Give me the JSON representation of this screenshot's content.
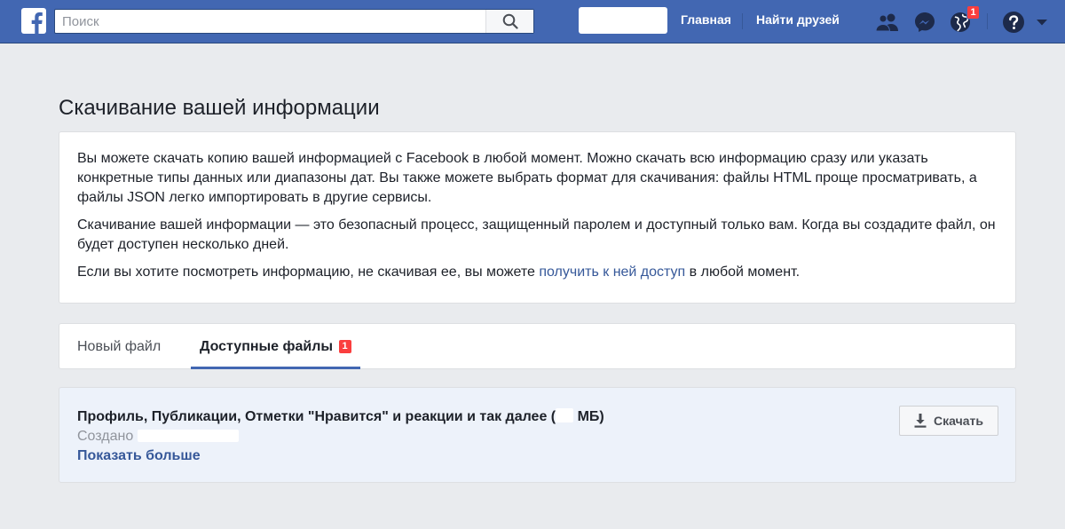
{
  "colors": {
    "topbar": "#4267b2",
    "page_bg": "#e9ebee",
    "link": "#365899",
    "badge": "#fa3e3e",
    "file_card_bg": "#edf2fa"
  },
  "topbar": {
    "logo_icon": "facebook-f-icon",
    "search": {
      "placeholder": "Поиск",
      "value": "",
      "icon": "search-icon"
    },
    "nav": {
      "home_label": "Главная",
      "find_friends_label": "Найти друзей"
    },
    "icons": [
      "friends-icon",
      "messenger-icon",
      "globe-notifications-icon",
      "help-icon",
      "chevron-down-icon"
    ],
    "notifications_badge": "1"
  },
  "page": {
    "title": "Скачивание вашей информации",
    "info": {
      "p1": "Вы можете скачать копию вашей информацией с Facebook в любой момент. Можно скачать всю информацию сразу или указать конкретные типы данных или диапазоны дат. Вы также можете выбрать формат для скачивания: файлы HTML проще просматривать, а файлы JSON легко импортировать в другие сервисы.",
      "p2": "Скачивание вашей информации — это безопасный процесс, защищенный паролем и доступный только вам. Когда вы создадите файл, он будет доступен несколько дней.",
      "p3_before": "Если вы хотите посмотреть информацию, не скачивая ее, вы можете ",
      "p3_link": "получить к ней доступ",
      "p3_after": " в любой момент."
    },
    "tabs": [
      {
        "label": "Новый файл",
        "active": false
      },
      {
        "label": "Доступные файлы",
        "active": true,
        "badge": "1"
      }
    ],
    "file": {
      "title_before": "Профиль, Публикации, Отметки \"Нравится\" и реакции и так далее (",
      "title_after": " МБ)",
      "created_label": "Создано",
      "show_more": "Показать больше",
      "download_label": "Скачать",
      "download_icon": "download-icon"
    }
  }
}
